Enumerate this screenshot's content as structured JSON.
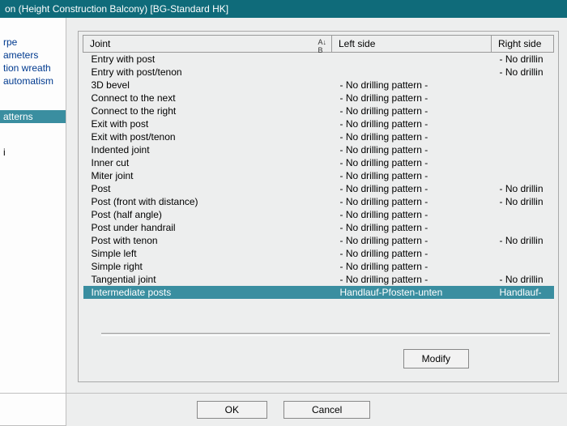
{
  "title": "on (Height Construction Balcony) [BG-Standard HK]",
  "sidebar": {
    "items": [
      {
        "label": "rpe",
        "cls": "item"
      },
      {
        "label": "ameters",
        "cls": "item"
      },
      {
        "label": "tion wreath",
        "cls": "item"
      },
      {
        "label": "automatism",
        "cls": "item"
      },
      {
        "label": "",
        "cls": "gap"
      },
      {
        "label": "",
        "cls": "gap"
      },
      {
        "label": "atterns",
        "cls": "item sel"
      },
      {
        "label": "",
        "cls": "gap"
      },
      {
        "label": "",
        "cls": "gap"
      },
      {
        "label": "i",
        "cls": "item black"
      }
    ]
  },
  "columns": {
    "joint": "Joint",
    "left": "Left side",
    "right": "Right side"
  },
  "rows": [
    {
      "joint": "Entry with post",
      "left": "",
      "right": "- No drillin"
    },
    {
      "joint": "Entry with post/tenon",
      "left": "",
      "right": "- No drillin"
    },
    {
      "joint": "3D bevel",
      "left": "- No drilling pattern -",
      "right": ""
    },
    {
      "joint": "Connect to the next",
      "left": "- No drilling pattern -",
      "right": ""
    },
    {
      "joint": "Connect to the right",
      "left": "- No drilling pattern -",
      "right": ""
    },
    {
      "joint": "Exit with post",
      "left": "- No drilling pattern -",
      "right": ""
    },
    {
      "joint": "Exit with post/tenon",
      "left": "- No drilling pattern -",
      "right": ""
    },
    {
      "joint": "Indented joint",
      "left": "- No drilling pattern -",
      "right": ""
    },
    {
      "joint": "Inner cut",
      "left": "- No drilling pattern -",
      "right": ""
    },
    {
      "joint": "Miter joint",
      "left": "- No drilling pattern -",
      "right": ""
    },
    {
      "joint": "Post",
      "left": "- No drilling pattern -",
      "right": "- No drillin"
    },
    {
      "joint": "Post (front with distance)",
      "left": "- No drilling pattern -",
      "right": "- No drillin"
    },
    {
      "joint": "Post (half angle)",
      "left": "- No drilling pattern -",
      "right": ""
    },
    {
      "joint": "Post under handrail",
      "left": "- No drilling pattern -",
      "right": ""
    },
    {
      "joint": "Post with tenon",
      "left": "- No drilling pattern -",
      "right": "- No drillin"
    },
    {
      "joint": "Simple left",
      "left": "- No drilling pattern -",
      "right": ""
    },
    {
      "joint": "Simple right",
      "left": "- No drilling pattern -",
      "right": ""
    },
    {
      "joint": "Tangential joint",
      "left": "- No drilling pattern -",
      "right": "- No drillin"
    },
    {
      "joint": "Intermediate posts",
      "left": "Handlauf-Pfosten-unten",
      "right": "Handlauf-",
      "sel": true
    }
  ],
  "buttons": {
    "modify": "Modify",
    "ok": "OK",
    "cancel": "Cancel"
  }
}
